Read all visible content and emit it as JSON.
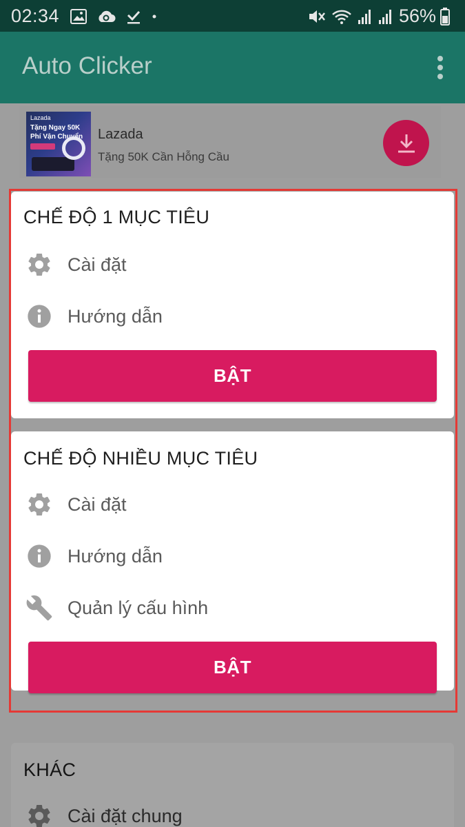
{
  "status_bar": {
    "time": "02:34",
    "battery": "56%"
  },
  "app_bar": {
    "title": "Auto Clicker"
  },
  "ad": {
    "image_brand": "Lazada",
    "image_line1": "Tặng Ngay 50K",
    "image_line2": "Phí Vận Chuyển",
    "title": "Lazada",
    "subtitle": "Tặng 50K Cần Hỗng Cầu"
  },
  "single_target": {
    "title": "CHẾ ĐỘ 1 MỤC TIÊU",
    "settings": "Cài đặt",
    "guide": "Hướng dẫn",
    "on_button": "BẬT"
  },
  "multi_target": {
    "title": "CHẾ ĐỘ NHIỀU MỤC TIÊU",
    "settings": "Cài đặt",
    "guide": "Hướng dẫn",
    "config": "Quản lý cấu hình",
    "on_button": "BẬT"
  },
  "other": {
    "title": "KHÁC",
    "general_settings": "Cài đặt chung"
  },
  "colors": {
    "status_bar": "#0d3f35",
    "app_bar": "#1b7566",
    "accent": "#d81b60",
    "highlight": "#e53935"
  },
  "icons": [
    "image-icon",
    "cloud-sync-icon",
    "download-done-icon",
    "mute-icon",
    "wifi-icon",
    "signal-icon",
    "battery-icon",
    "overflow-menu-icon",
    "download-icon",
    "gear-icon",
    "info-icon",
    "wrench-icon"
  ]
}
